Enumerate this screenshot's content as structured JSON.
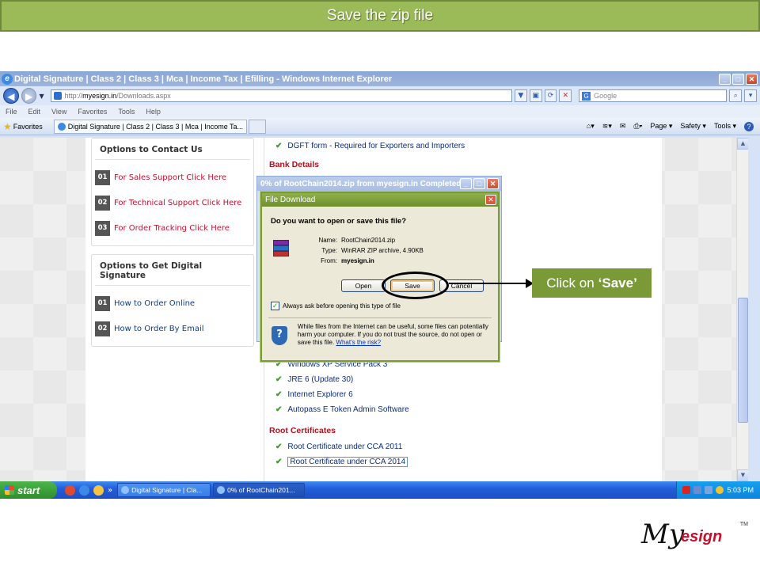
{
  "slide": {
    "title": "Save the zip file",
    "callout_prefix": "Click on",
    "callout_action": "‘Save’"
  },
  "browser": {
    "window_title": "Digital Signature | Class 2 | Class 3 | Mca | Income Tax | Efilling - Windows Internet Explorer",
    "url_prefix": "http://",
    "url_domain": "myesign.in",
    "url_path": "/Downloads.aspx",
    "search_placeholder": "Google",
    "menu": [
      "File",
      "Edit",
      "View",
      "Favorites",
      "Tools",
      "Help"
    ],
    "favorites_label": "Favorites",
    "tab_title": "Digital Signature | Class 2 | Class 3 | Mca | Income Ta...",
    "cmd": {
      "page": "Page ▾",
      "safety": "Safety ▾",
      "tools": "Tools ▾"
    }
  },
  "page": {
    "contact_box": {
      "title": "Options to Contact Us",
      "items": [
        {
          "num": "01",
          "label": "For Sales Support Click Here"
        },
        {
          "num": "02",
          "label": "For Technical Support Click Here"
        },
        {
          "num": "03",
          "label": "For Order Tracking Click Here"
        }
      ]
    },
    "get_box": {
      "title": "Options to Get Digital Signature",
      "items": [
        {
          "num": "01",
          "label": "How to Order Online"
        },
        {
          "num": "02",
          "label": "How to Order By Email"
        }
      ]
    },
    "top_item": "DGFT form - Required for Exporters and Importers",
    "bank_heading": "Bank Details",
    "downloads": [
      "Windows XP Service Pack 3",
      "JRE 6 (Update 30)",
      "Internet Explorer 6",
      "Autopass E Token Admin Software"
    ],
    "root_heading": "Root Certificates",
    "root_items": [
      "Root Certificate under CCA 2011",
      "Root Certificate under CCA 2014"
    ]
  },
  "progress_dialog": {
    "title": "0% of RootChain2014.zip from myesign.in Completed"
  },
  "file_download": {
    "title": "File Download",
    "question": "Do you want to open or save this file?",
    "name_label": "Name:",
    "name_value": "RootChain2014.zip",
    "type_label": "Type:",
    "type_value": "WinRAR ZIP archive, 4.90KB",
    "from_label": "From:",
    "from_value": "myesign.in",
    "open_button": "Open",
    "save_button": "Save",
    "cancel_button": "Cancel",
    "ask_label": "Always ask before opening this type of file",
    "ask_checked": true,
    "warning": "While files from the Internet can be useful, some files can potentially harm your computer. If you do not trust the source, do not open or save this file.",
    "risk_link": "What's the risk?"
  },
  "taskbar": {
    "start": "start",
    "task1": "Digital Signature | Cla...",
    "task2": "0% of RootChain201...",
    "clock": "5:03 PM"
  },
  "logo": {
    "my": "My",
    "esign": "esign",
    "tm": "TM"
  }
}
